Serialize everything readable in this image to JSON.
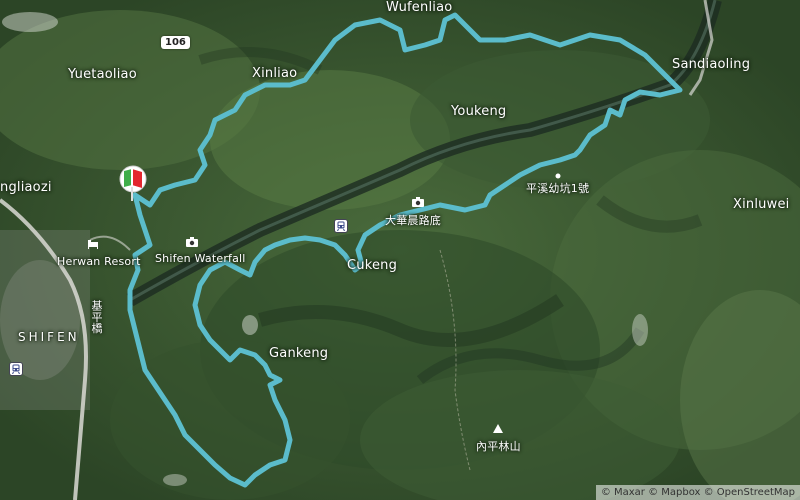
{
  "map": {
    "labels": {
      "wufenliao": "Wufenliao",
      "yuetaoliao": "Yuetaoliao",
      "xinliao": "Xinliao",
      "sandiaoling": "Sandiaoling",
      "youkeng": "Youkeng",
      "pingxi_mine": "平溪幼坑1號",
      "xinluwei": "Xinluwei",
      "ngliaozi": "ngliaozi",
      "herwan_resort": "Herwan Resort",
      "shifen_waterfall": "Shifen Waterfall",
      "dahua_trail": "大華晨路底",
      "cukeng": "Cukeng",
      "shifen": "SHIFEN",
      "gankeng": "Gankeng",
      "neiping_mountain": "內平林山",
      "road_vertical": "基平橋"
    },
    "road_shield": "106",
    "attribution": "© Maxar © Mapbox © OpenStreetMap",
    "route_color": "#5bbccb",
    "flag_colors": {
      "red": "#e3262e",
      "green": "#3fae49"
    }
  }
}
